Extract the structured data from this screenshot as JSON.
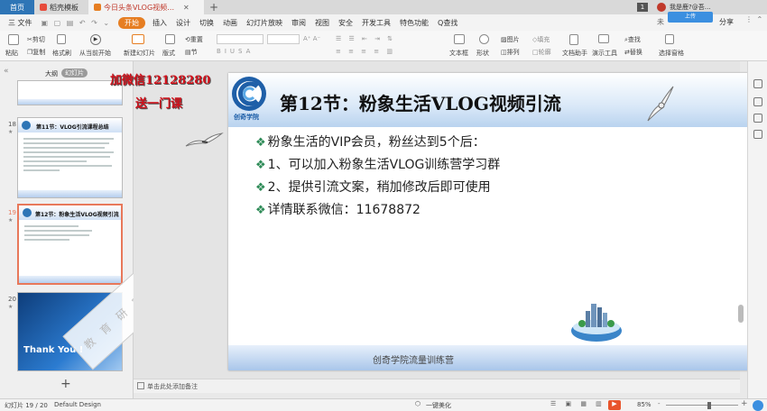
{
  "titlebar": {
    "tabs": [
      {
        "label": "首页"
      },
      {
        "label": "稻壳模板"
      },
      {
        "label": "今日头条VLOG视频引流课程"
      }
    ],
    "new_tab": "+",
    "page_badge": "1",
    "user_label": "我是鹿?@吾…",
    "upload_label": "上传"
  },
  "menubar": {
    "file": "三 文件",
    "items": [
      "开始",
      "插入",
      "设计",
      "切换",
      "动画",
      "幻灯片放映",
      "审阅",
      "视图",
      "安全",
      "开发工具",
      "特色功能"
    ],
    "active": "开始",
    "search": "Q查找",
    "share": "分享",
    "sync": "未"
  },
  "ribbon": {
    "paste": "粘贴",
    "cut": "剪切",
    "copy": "复制",
    "format_painter": "格式刷",
    "play_from_current": "从当前开始",
    "new_slide": "新建幻灯片",
    "layout": "版式",
    "section": "节",
    "reset": "重置",
    "text_box": "文本框",
    "shape": "形状",
    "arrange": "排列",
    "picture": "图片",
    "fill": "填充",
    "outline": "轮廓",
    "doc_assistant": "文档助手",
    "presenter_tools": "演示工具",
    "find": "查找",
    "replace": "替换",
    "select_pane": "选择窗格",
    "font_icons": [
      "B",
      "I",
      "U",
      "S",
      "A"
    ]
  },
  "leftpanel": {
    "tab_outline": "大纲",
    "tab_slides": "幻灯片",
    "collapse": "«",
    "thumbs": [
      {
        "num": "18",
        "title": "第11节：VLOG引流课程总结"
      },
      {
        "num": "19",
        "title": "第12节：粉象生活VLOG视频引流"
      },
      {
        "num": "20",
        "title": "Thank You !"
      }
    ],
    "add": "+",
    "thumb20_watermark": "教 育 研 究 院"
  },
  "overlay": {
    "red_line1": "加微信12128280",
    "red_line2": "送一门课"
  },
  "slide": {
    "logo_text": "创奇学院",
    "title": "第12节：粉象生活VLOG视频引流",
    "bullets": [
      "粉象生活的VIP会员，粉丝达到5个后：",
      "1、可以加入粉象生活VLOG训练营学习群",
      "2、提供引流文案，稍加修改后即可使用",
      "详情联系微信：11678872"
    ],
    "bullet_glyph": "❖",
    "footer": "创奇学院流量训练营"
  },
  "notes": {
    "placeholder": "单击此处添加备注"
  },
  "status": {
    "slide_count": "幻灯片 19 / 20",
    "theme": "Default Design",
    "beautify": "一键美化",
    "zoom": "85%",
    "zoom_minus": "-",
    "zoom_plus": "+"
  },
  "colors": {
    "accent": "#e67e22",
    "tab_blue": "#2e75b6",
    "watermark_red": "#d1111b"
  }
}
